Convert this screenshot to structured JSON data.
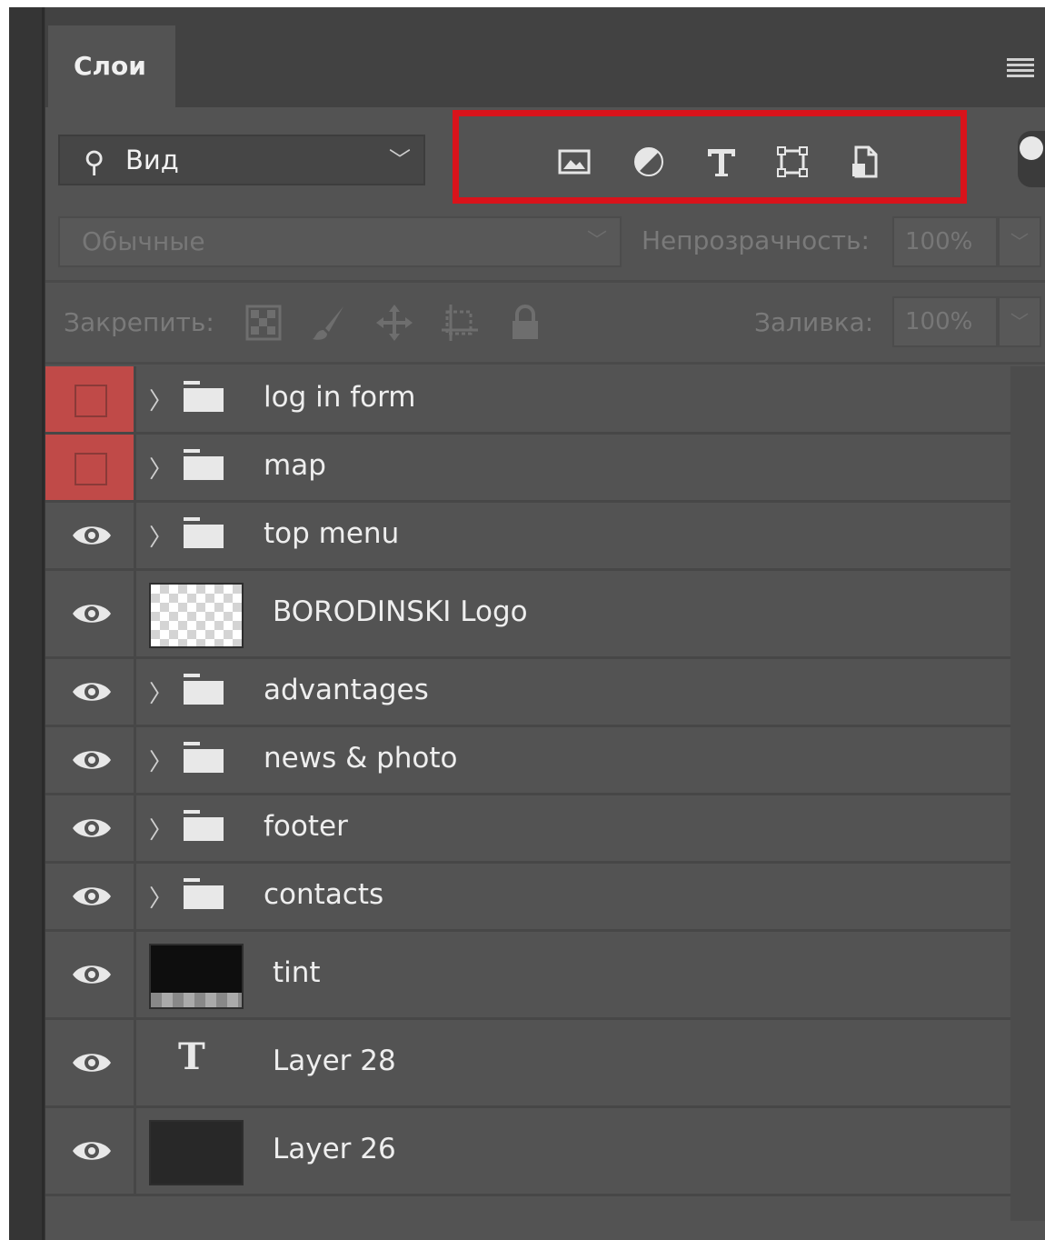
{
  "panel": {
    "tab_label": "Слои",
    "filter": {
      "kind_value": "Вид",
      "icons": [
        "image-filter-icon",
        "adjustment-filter-icon",
        "type-filter-icon",
        "shape-filter-icon",
        "smart-object-filter-icon"
      ]
    },
    "blend_mode": "Обычные",
    "opacity_label": "Непрозрачность:",
    "opacity_value": "100%",
    "lock_label": "Закрепить:",
    "fill_label": "Заливка:",
    "fill_value": "100%",
    "highlight_color": "#d9131b"
  },
  "layers": [
    {
      "name": "log in form",
      "kind": "group",
      "visible": false
    },
    {
      "name": "map",
      "kind": "group",
      "visible": false
    },
    {
      "name": "top menu",
      "kind": "group",
      "visible": true
    },
    {
      "name": "BORODINSKI Logo",
      "kind": "image-transparent",
      "visible": true
    },
    {
      "name": "advantages",
      "kind": "group",
      "visible": true
    },
    {
      "name": "news & photo",
      "kind": "group",
      "visible": true
    },
    {
      "name": "footer",
      "kind": "group",
      "visible": true
    },
    {
      "name": "contacts",
      "kind": "group",
      "visible": true
    },
    {
      "name": "tint",
      "kind": "image-dark",
      "visible": true
    },
    {
      "name": "Layer 28",
      "kind": "text",
      "visible": true
    },
    {
      "name": "Layer 26",
      "kind": "image-solid",
      "visible": true
    }
  ]
}
